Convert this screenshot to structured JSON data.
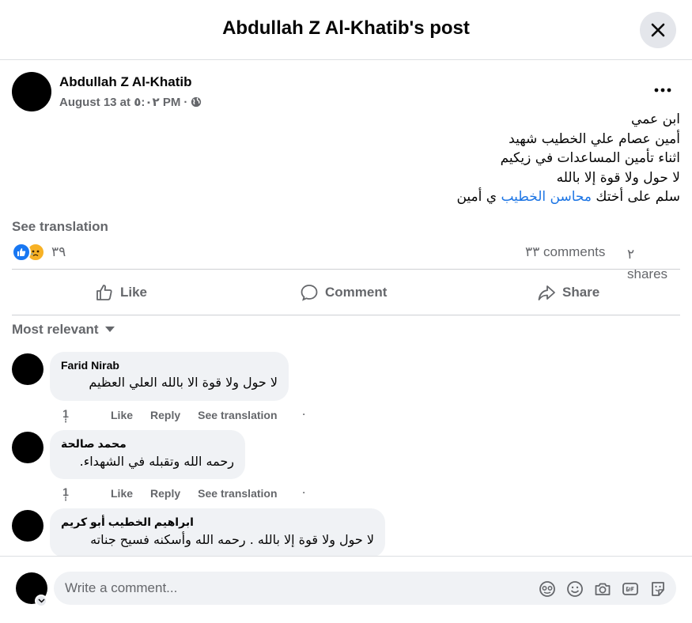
{
  "modal": {
    "title": "Abdullah Z Al-Khatib's post"
  },
  "post": {
    "author": "Abdullah Z Al-Khatib",
    "timestamp": "August 13 at ٥:٠٢ PM",
    "separator": "·",
    "audience_icon": "globe-icon",
    "lines": [
      "ابن عمي",
      "أمين عصام علي الخطيب شهيد",
      "اثناء تأمين المساعدات في زيكيم",
      "لا حول ولا قوة إلا بالله"
    ],
    "last_line_prefix": "سلم على أختك ",
    "last_line_tag": "محاسن الخطيب",
    "last_line_suffix": "  ي أمين",
    "see_translation": "See translation"
  },
  "stats": {
    "reaction_count": "٣٩",
    "comments": "٣٣ comments",
    "shares_count": "٢",
    "shares_label": "shares"
  },
  "actions": {
    "like": "Like",
    "comment": "Comment",
    "share": "Share"
  },
  "sort": {
    "label": "Most relevant"
  },
  "comments": [
    {
      "name": "Farid Nirab",
      "text": "لا حول ولا قوة الا بالله العلي العظيم",
      "time": "1",
      "like": "Like",
      "reply": "Reply",
      "translate": "See translation",
      "dot": "·"
    },
    {
      "name": "محمد صالحة",
      "text": "رحمه الله وتقبله في الشهداء.",
      "time": "1",
      "like": "Like",
      "reply": "Reply",
      "translate": "See translation",
      "dot": "·"
    },
    {
      "name": "ابراهيم الخطيب أبو كريم",
      "text": "لا حول ولا قوة إلا بالله . رحمه الله وأسكنه فسيح جناته"
    }
  ],
  "composer": {
    "placeholder": "Write a comment...",
    "icons": [
      "avatar-sticker-icon",
      "emoji-icon",
      "camera-icon",
      "gif-icon",
      "sticker-icon"
    ]
  },
  "colors": {
    "link": "#1b74e4",
    "like_blue": "#1877f2",
    "sad_yellow": "#f7b125",
    "secondary_text": "#65676b",
    "bubble_bg": "#f0f2f5"
  }
}
